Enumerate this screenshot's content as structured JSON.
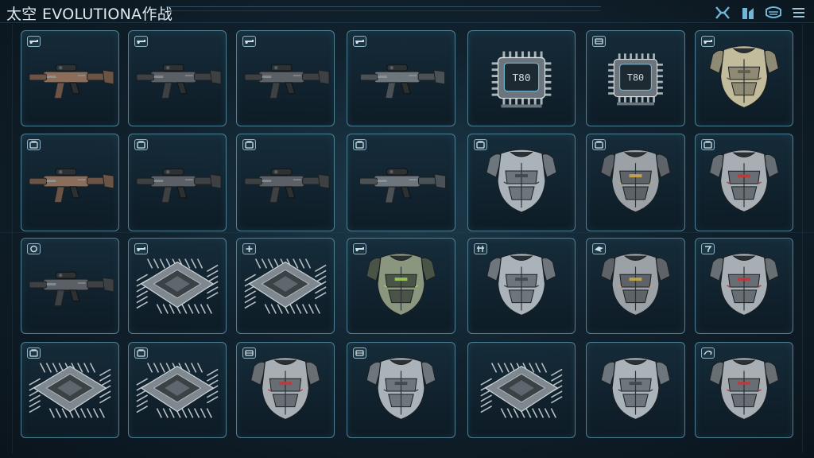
{
  "title": "太空 EVOLUTIONA作战",
  "toolbar": {
    "icons": [
      "crossed-swords-icon",
      "rank-icon",
      "helmet-icon",
      "menu-icon"
    ]
  },
  "chip_label": "T80",
  "inventory": [
    {
      "type": "rifle",
      "badge": "gun-icon",
      "variant": "brown"
    },
    {
      "type": "rifle",
      "badge": "gun-icon",
      "variant": "dark"
    },
    {
      "type": "rifle",
      "badge": "gun-icon",
      "variant": "dark"
    },
    {
      "type": "rifle",
      "badge": "gun-icon",
      "variant": "gray"
    },
    {
      "type": "chip-front",
      "badge": "none",
      "label": "T80"
    },
    {
      "type": "chip-front",
      "badge": "card-icon",
      "label": "T80"
    },
    {
      "type": "armor",
      "badge": "gun-icon",
      "variant": "tan"
    },
    {
      "type": "rifle",
      "badge": "bag-icon",
      "variant": "brown"
    },
    {
      "type": "rifle",
      "badge": "bag-icon",
      "variant": "dark"
    },
    {
      "type": "rifle",
      "badge": "bag-icon",
      "variant": "dark"
    },
    {
      "type": "rifle",
      "badge": "bag-icon",
      "variant": "gray"
    },
    {
      "type": "armor",
      "badge": "bag-icon",
      "variant": "steel"
    },
    {
      "type": "armor",
      "badge": "bag-icon",
      "variant": "gold"
    },
    {
      "type": "armor",
      "badge": "bag-icon",
      "variant": "red"
    },
    {
      "type": "rifle",
      "badge": "ring-icon",
      "variant": "dark"
    },
    {
      "type": "chip",
      "badge": "gun-icon"
    },
    {
      "type": "chip",
      "badge": "plus-icon"
    },
    {
      "type": "armor",
      "badge": "gun-icon",
      "variant": "green"
    },
    {
      "type": "armor",
      "badge": "grid-icon",
      "variant": "steel"
    },
    {
      "type": "armor",
      "badge": "bird-icon",
      "variant": "gold"
    },
    {
      "type": "armor",
      "badge": "hook-icon",
      "variant": "red"
    },
    {
      "type": "chip",
      "badge": "bag-icon"
    },
    {
      "type": "chip",
      "badge": "bag-icon"
    },
    {
      "type": "armor",
      "badge": "card-icon",
      "variant": "red"
    },
    {
      "type": "armor",
      "badge": "card-icon",
      "variant": "steel"
    },
    {
      "type": "chip",
      "badge": "none"
    },
    {
      "type": "armor",
      "badge": "none",
      "variant": "steel"
    },
    {
      "type": "armor",
      "badge": "arrow-icon",
      "variant": "red"
    }
  ],
  "colors": {
    "slot_border": "#4f7f92",
    "accent": "#6fb6d8",
    "metal": "#8a949a"
  }
}
